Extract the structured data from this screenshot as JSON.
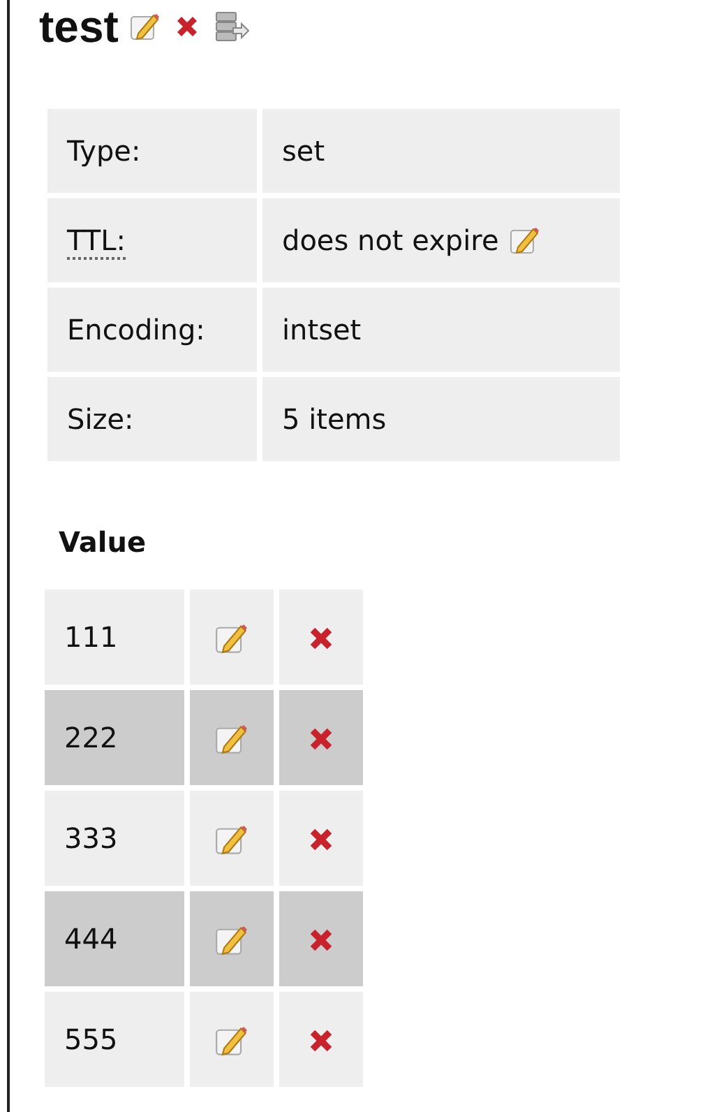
{
  "title": "test",
  "info": [
    {
      "label": "Type:",
      "value": "set",
      "editable": false,
      "abbr": false
    },
    {
      "label": "TTL:",
      "value": "does not expire",
      "editable": true,
      "abbr": true
    },
    {
      "label": "Encoding:",
      "value": "intset",
      "editable": false,
      "abbr": false
    },
    {
      "label": "Size:",
      "value": "5 items",
      "editable": false,
      "abbr": false
    }
  ],
  "values_heading": "Value",
  "values": [
    "111",
    "222",
    "333",
    "444",
    "555"
  ]
}
